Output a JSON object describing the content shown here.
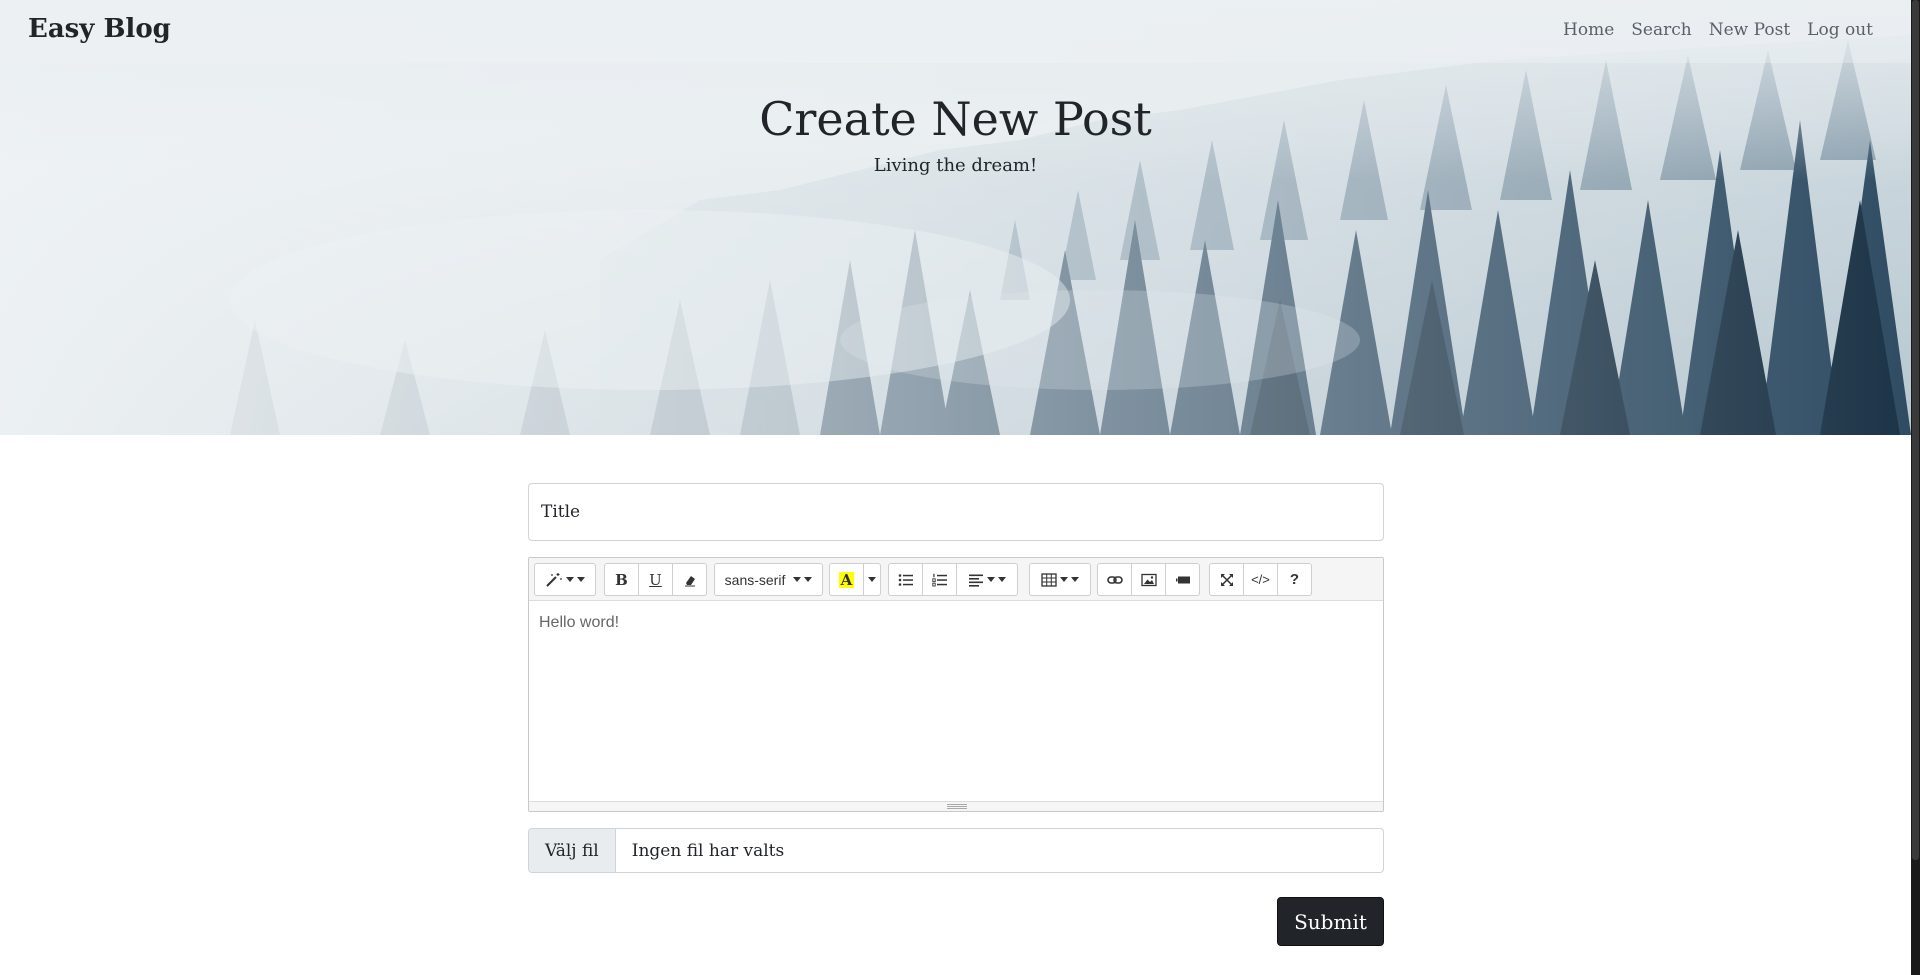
{
  "brand": "Easy Blog",
  "nav": {
    "items": [
      "Home",
      "Search",
      "New Post",
      "Log out"
    ]
  },
  "hero": {
    "title": "Create New Post",
    "subtitle": "Living the dream!"
  },
  "form": {
    "title_placeholder": "Title",
    "editor": {
      "font_family_select": "sans-serif",
      "content": "Hello word!"
    },
    "file": {
      "button_label": "Välj fil",
      "status": "Ingen fil har valts"
    },
    "submit_label": "Submit"
  },
  "colors": {
    "brand_dark": "#212529",
    "highlight_yellow": "#ffff00"
  }
}
